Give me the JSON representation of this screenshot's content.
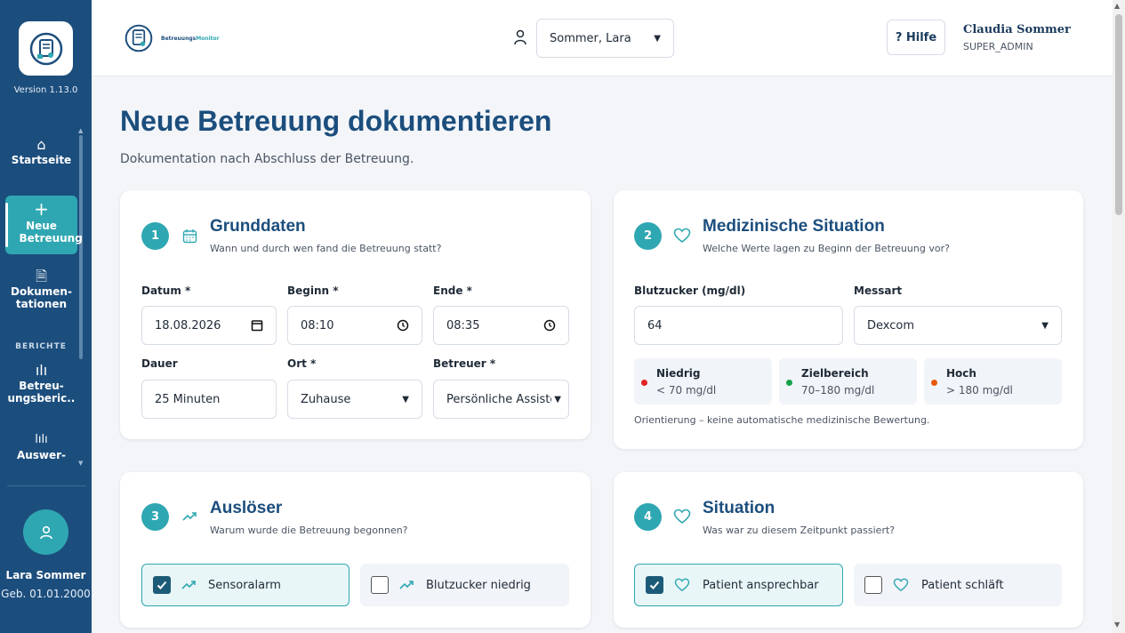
{
  "app": {
    "version": "Version 1.13.0",
    "brand_name": "Betreuungs",
    "brand_accent": "Monitor"
  },
  "sidebar": {
    "items": [
      {
        "label": "Startseite",
        "icon": "home-icon"
      },
      {
        "label": "Neue Betreuung",
        "icon": "plus-icon",
        "active": true
      },
      {
        "label": "Dokumen-tationen",
        "icon": "document-icon"
      },
      {
        "label": "Betreu-ungsberic...",
        "icon": "bar-chart-icon"
      },
      {
        "label": "Auswer-",
        "icon": "analytics-icon"
      }
    ],
    "section_label": "BERICHTE",
    "patient": {
      "name": "Lara Sommer",
      "dob": "Geb. 01.01.2000"
    }
  },
  "header": {
    "patient_select": "Sommer, Lara",
    "help_label": "? Hilfe",
    "user_name": "Claudia Sommer",
    "user_role": "SUPER_ADMIN"
  },
  "page": {
    "title": "Neue Betreuung dokumentieren",
    "subtitle": "Dokumentation nach Abschluss der Betreuung."
  },
  "cards": {
    "grunddaten": {
      "step": "1",
      "title": "Grunddaten",
      "subtitle": "Wann und durch wen fand die Betreuung statt?",
      "labels": {
        "datum": "Datum *",
        "beginn": "Beginn *",
        "ende": "Ende *",
        "dauer": "Dauer",
        "ort": "Ort *",
        "betreuer": "Betreuer *"
      },
      "values": {
        "datum": "18.08.2026",
        "beginn": "08:10",
        "ende": "08:35",
        "dauer": "25 Minuten",
        "ort": "Zuhause",
        "betreuer": "Persönliche Assiste"
      }
    },
    "medizin": {
      "step": "2",
      "title": "Medizinische Situation",
      "subtitle": "Welche Werte lagen zu Beginn der Betreuung vor?",
      "labels": {
        "blutzucker": "Blutzucker (mg/dl)",
        "messart": "Messart"
      },
      "values": {
        "blutzucker": "64",
        "messart": "Dexcom"
      },
      "ranges": [
        {
          "title": "Niedrig",
          "value": "< 70 mg/dl",
          "color": "#e02424"
        },
        {
          "title": "Zielbereich",
          "value": "70–180 mg/dl",
          "color": "#16a34a"
        },
        {
          "title": "Hoch",
          "value": "> 180 mg/dl",
          "color": "#ea580c"
        }
      ],
      "note": "Orientierung – keine automatische medizinische Bewertung."
    },
    "ausloeser": {
      "step": "3",
      "title": "Auslöser",
      "subtitle": "Warum wurde die Betreuung begonnen?",
      "options": [
        {
          "label": "Sensoralarm",
          "checked": true
        },
        {
          "label": "Blutzucker niedrig",
          "checked": false
        }
      ]
    },
    "situation": {
      "step": "4",
      "title": "Situation",
      "subtitle": "Was war zu diesem Zeitpunkt passiert?",
      "options": [
        {
          "label": "Patient ansprechbar",
          "checked": true
        },
        {
          "label": "Patient schläft",
          "checked": false
        }
      ]
    }
  },
  "colors": {
    "primary": "#1c4e7d",
    "accent": "#2fa7b2",
    "background": "#f3f5f9"
  }
}
